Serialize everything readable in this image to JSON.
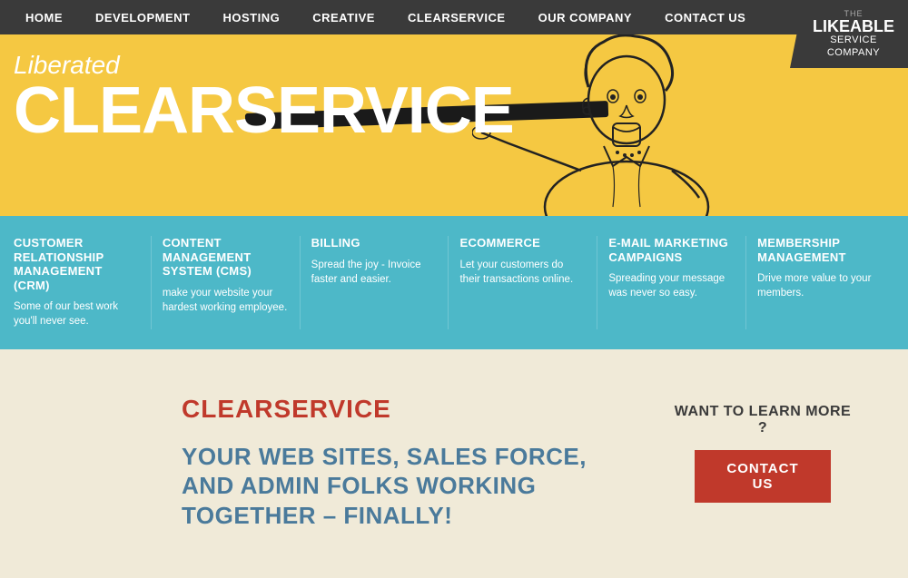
{
  "brand": {
    "the": "THE",
    "likeable": "LIKEABLE",
    "service_company": "SERVICE\nCOMPANY"
  },
  "nav": {
    "items": [
      {
        "label": "HOME",
        "url": "#"
      },
      {
        "label": "DEVELOPMENT",
        "url": "#"
      },
      {
        "label": "HOSTING",
        "url": "#"
      },
      {
        "label": "CREATIVE",
        "url": "#"
      },
      {
        "label": "CLEARSERVICE",
        "url": "#"
      },
      {
        "label": "OUR COMPANY",
        "url": "#"
      },
      {
        "label": "CONTACT US",
        "url": "#"
      }
    ]
  },
  "hero": {
    "liberated": "Liberated",
    "clearservice": "CLEARSERVICE"
  },
  "features": [
    {
      "title": "CUSTOMER RELATIONSHIP MANAGEMENT (CRM)",
      "description": "Some of our best work you'll never see."
    },
    {
      "title": "CONTENT MANAGEMENT SYSTEM (CMS)",
      "description": "make your website your hardest working employee."
    },
    {
      "title": "BILLING",
      "description": "Spread the joy - Invoice faster and easier."
    },
    {
      "title": "ECOMMERCE",
      "description": "Let your customers do their transactions online."
    },
    {
      "title": "E-MAIL MARKETING CAMPAIGNS",
      "description": "Spreading your message was never so easy."
    },
    {
      "title": "MEMBERSHIP MANAGEMENT",
      "description": "Drive more value to your members."
    }
  ],
  "main": {
    "cs_title": "CLEARSERVICE",
    "tagline": "YOUR WEB SITES, SALES FORCE, AND ADMIN FOLKS WORKING TOGETHER – FINALLY!",
    "want_to_learn": "WANT TO LEARN MORE ?",
    "contact_btn": "CONTACT US"
  }
}
